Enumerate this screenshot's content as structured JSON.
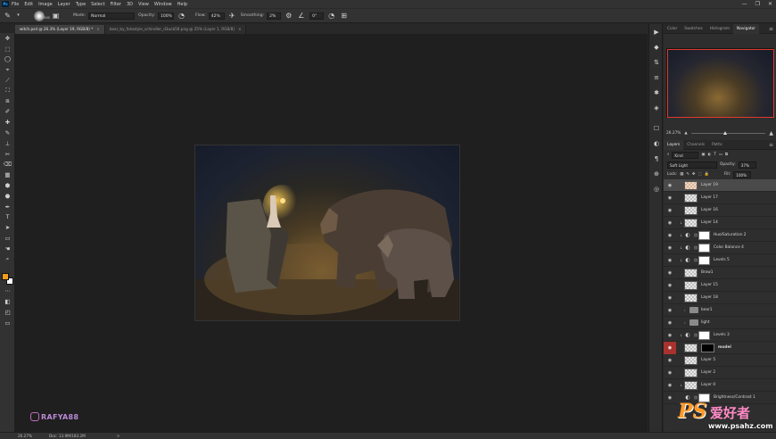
{
  "app": {
    "logo": "Ps"
  },
  "menu": [
    "File",
    "Edit",
    "Image",
    "Layer",
    "Type",
    "Select",
    "Filter",
    "3D",
    "View",
    "Window",
    "Help"
  ],
  "window_controls": [
    "—",
    "❐",
    "✕"
  ],
  "options": {
    "brush_size": "1300",
    "mode_label": "Mode:",
    "mode_value": "Normal",
    "opacity_label": "Opacity:",
    "opacity_value": "100%",
    "flow_label": "Flow:",
    "flow_value": "42%",
    "smoothing_label": "Smoothing:",
    "smoothing_value": "2%",
    "angle_value": "0°"
  },
  "tabs": [
    {
      "label": "witch.psd @ 26.3% (Layer 19, RGB/8) *",
      "close": "×"
    },
    {
      "label": "bear_by_fotostyle_schindler_d3ucb56.png @ 25% (Layer 1, RGB/8)",
      "close": "×"
    }
  ],
  "tools": [
    "✥",
    "⬚",
    "◯",
    "⌖",
    "⟋",
    "⛶",
    "⧈",
    "✐",
    "✚",
    "✎",
    "⊥",
    "✂",
    "⌫",
    "▦",
    "⬢",
    "⬣",
    "✒",
    "T",
    "➤",
    "▭",
    "☚",
    "⌕",
    "⋯",
    "◧",
    "◰",
    "▭"
  ],
  "dock_icons": [
    "▶",
    "◆",
    "⇅",
    "≡",
    "✱",
    "◈",
    "☐",
    "◐",
    "¶",
    "⊕",
    "◎"
  ],
  "top_panel_tabs": [
    "Color",
    "Swatches",
    "Histogram",
    "Navigator"
  ],
  "top_panel_active": 3,
  "navigator_zoom": "26.27%",
  "navigator_zoom_fraction": 0.43,
  "layers_panel_tabs": [
    "Layers",
    "Channels",
    "Paths"
  ],
  "layers_panel_active": 0,
  "panel_menu": "≡",
  "filter": {
    "kind": "Kind"
  },
  "blend": {
    "mode": "Soft Light",
    "opacity_label": "Opacity:",
    "opacity_value": "37%"
  },
  "lock": {
    "label": "Lock:",
    "fill_label": "Fill:",
    "fill_value": "100%"
  },
  "layers": [
    {
      "name": "Layer 19",
      "type": "pixel",
      "selected": true,
      "clip": false
    },
    {
      "name": "Layer 17",
      "type": "pixel",
      "clip": false
    },
    {
      "name": "Layer 16",
      "type": "pixel",
      "clip": false
    },
    {
      "name": "Layer 14",
      "type": "pixel",
      "clip": true
    },
    {
      "name": "Hue/Saturation 2",
      "type": "adjust",
      "clip": true
    },
    {
      "name": "Color Balance 4",
      "type": "adjust",
      "clip": true
    },
    {
      "name": "Levels 5",
      "type": "adjust",
      "clip": true
    },
    {
      "name": "Brow1",
      "type": "pixel",
      "clip": false
    },
    {
      "name": "Layer 15",
      "type": "pixel",
      "clip": false
    },
    {
      "name": "Layer 18",
      "type": "pixel",
      "clip": false
    },
    {
      "name": "bear1",
      "type": "group",
      "clip": false
    },
    {
      "name": "light",
      "type": "group",
      "clip": false
    },
    {
      "name": "Levels 3",
      "type": "adjust",
      "clip": true
    },
    {
      "name": "model",
      "type": "mask",
      "clip": false,
      "eye_red": true
    },
    {
      "name": "Layer 5",
      "type": "pixel",
      "clip": false
    },
    {
      "name": "Layer 2",
      "type": "pixel",
      "clip": false
    },
    {
      "name": "Layer 0",
      "type": "pixel",
      "clip": true
    },
    {
      "name": "Brightness/Contrast 1",
      "type": "adjust",
      "clip": false
    }
  ],
  "status": {
    "zoom": "26.27%",
    "doc": "Doc: 13.9M/183.2M",
    "arrow": ">"
  },
  "watermark": {
    "instagram_handle": "RAFYA88"
  },
  "site_watermark": {
    "big": "PS",
    "cn": "爱好者",
    "url": "www.psahz.com"
  },
  "colors": {
    "foreground": "#f39b1f",
    "background": "#ffffff",
    "selection_accent": "#e03a2c"
  }
}
